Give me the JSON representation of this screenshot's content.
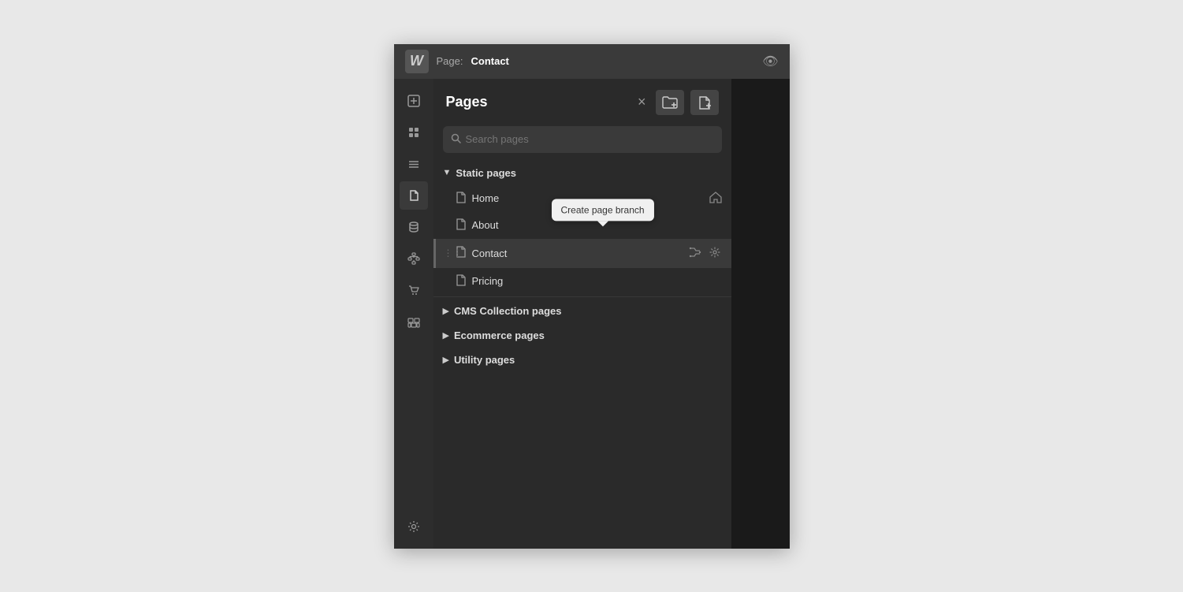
{
  "topbar": {
    "logo": "W",
    "page_label": "Page:",
    "page_name": "Contact"
  },
  "sidebar": {
    "icons": [
      {
        "name": "plus-icon",
        "symbol": "＋",
        "active": false
      },
      {
        "name": "box-icon",
        "symbol": "⬡",
        "active": false
      },
      {
        "name": "layers-icon",
        "symbol": "☰",
        "active": false
      },
      {
        "name": "page-icon",
        "symbol": "📄",
        "active": true
      },
      {
        "name": "database-icon",
        "symbol": "🗄",
        "active": false
      },
      {
        "name": "sitemap-icon",
        "symbol": "⛓",
        "active": false
      },
      {
        "name": "cart-icon",
        "symbol": "🛒",
        "active": false
      },
      {
        "name": "images-icon",
        "symbol": "🖼",
        "active": false
      },
      {
        "name": "settings-icon",
        "symbol": "⚙",
        "active": false
      }
    ]
  },
  "panel": {
    "title": "Pages",
    "close_label": "×",
    "btn_folder_add": "📁+",
    "btn_page_add": "📄+"
  },
  "search": {
    "placeholder": "Search pages"
  },
  "sections": {
    "static_pages": {
      "label": "Static pages",
      "pages": [
        {
          "name": "Home",
          "has_home_icon": true
        },
        {
          "name": "About",
          "has_tooltip": true
        },
        {
          "name": "Contact",
          "is_active": true
        },
        {
          "name": "Pricing"
        }
      ]
    },
    "cms_collection_pages": {
      "label": "CMS Collection pages"
    },
    "ecommerce_pages": {
      "label": "Ecommerce pages"
    },
    "utility_pages": {
      "label": "Utility pages"
    }
  },
  "tooltip": {
    "text": "Create page branch"
  }
}
